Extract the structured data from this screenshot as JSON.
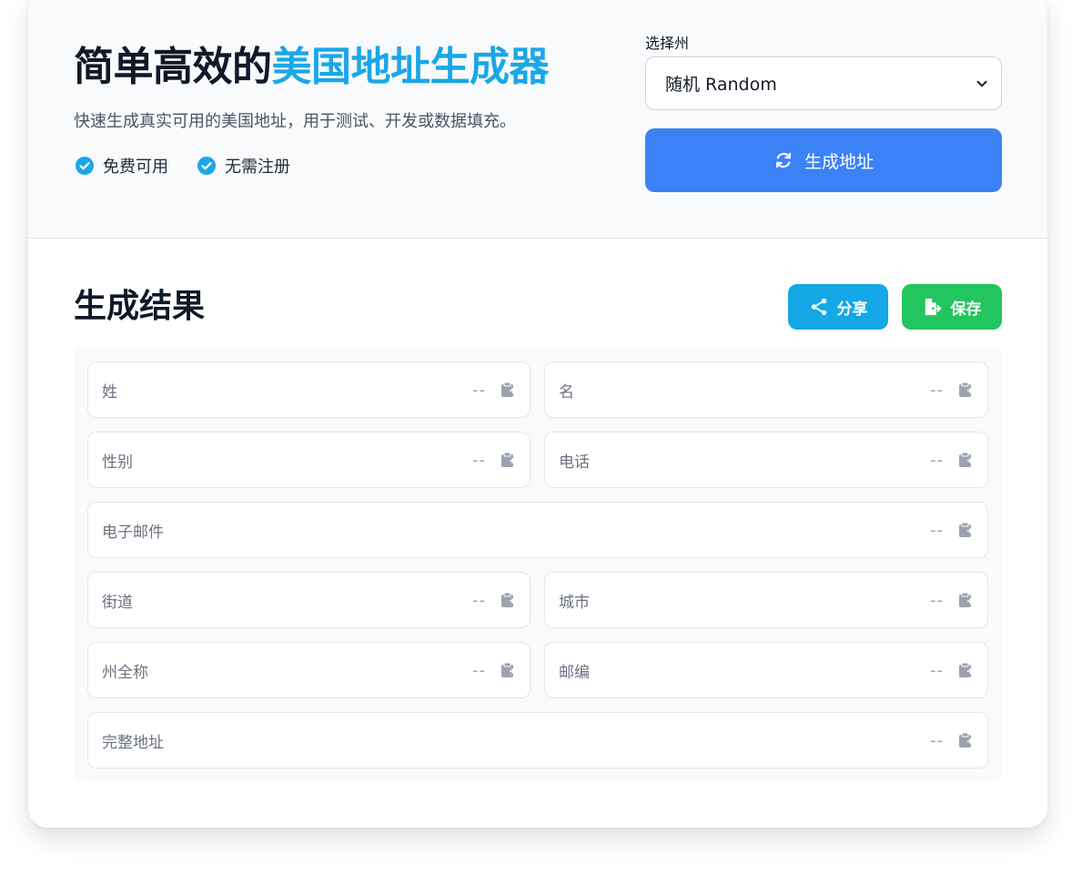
{
  "hero": {
    "title_plain": "简单高效的",
    "title_accent": "美国地址生成器",
    "subtitle": "快速生成真实可用的美国地址，用于测试、开发或数据填充。",
    "features": [
      "免费可用",
      "无需注册"
    ]
  },
  "state_picker": {
    "label": "选择州",
    "selected": "随机 Random"
  },
  "generate_button": {
    "label": "生成地址",
    "icon": "refresh-icon"
  },
  "results": {
    "title": "生成结果",
    "share_label": "分享",
    "save_label": "保存",
    "fields": [
      {
        "label": "姓",
        "value": "--"
      },
      {
        "label": "名",
        "value": "--"
      },
      {
        "label": "性别",
        "value": "--"
      },
      {
        "label": "电话",
        "value": "--"
      },
      {
        "label": "电子邮件",
        "value": "--"
      },
      {
        "label": "街道",
        "value": "--"
      },
      {
        "label": "城市",
        "value": "--"
      },
      {
        "label": "州全称",
        "value": "--"
      },
      {
        "label": "邮编",
        "value": "--"
      },
      {
        "label": "完整地址",
        "value": "--"
      }
    ]
  },
  "colors": {
    "accent": "#1aa7e8",
    "primary_button": "#3b82f6",
    "share_button": "#14a8e6",
    "save_button": "#22c55e",
    "check_icon": "#1aa7e8"
  }
}
